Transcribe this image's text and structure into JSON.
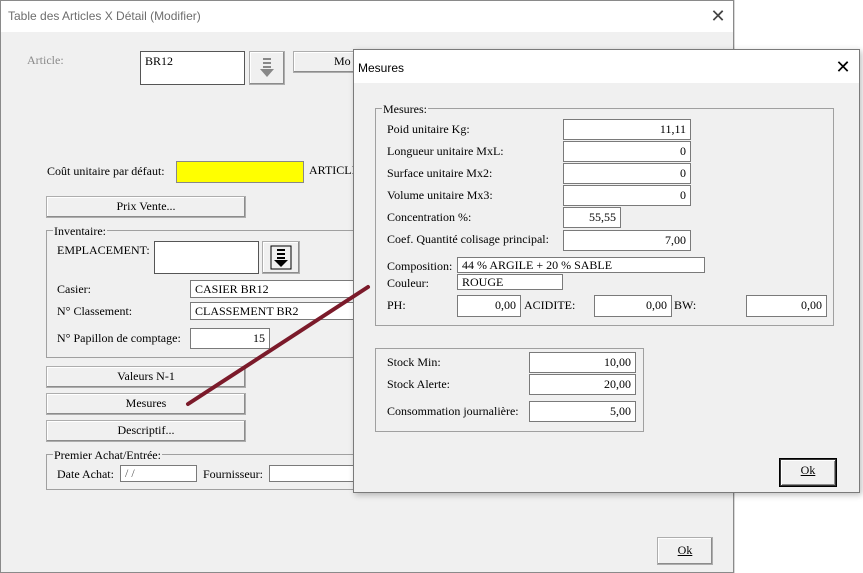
{
  "background_window": {
    "title": "Table des Articles X Détail (Modifier)",
    "article_label": "Article:",
    "article_value": "BR12",
    "mo_button_label": "Mo",
    "cout_label": "Coût unitaire par défaut:",
    "cout_value": "",
    "articles_partial": "ARTICLI",
    "prix_vente_button": "Prix Vente...",
    "inventaire_title": "Inventaire:",
    "emplacement_label": "EMPLACEMENT:",
    "emplacement_value": "",
    "casier_label": "Casier:",
    "casier_value": "CASIER BR12",
    "classement_label": "N° Classement:",
    "classement_value": "CLASSEMENT BR2",
    "papillon_label": "N° Papillon de comptage:",
    "papillon_value": "15",
    "valeurs_button": "Valeurs N-1",
    "mesures_button": "Mesures",
    "descriptif_button": "Descriptif...",
    "premier_title": "Premier Achat/Entrée:",
    "date_achat_label": "Date Achat:",
    "date_achat_value": " / /",
    "fournisseur_label": "Fournisseur:",
    "fournisseur_value": "",
    "ok_button": "Ok",
    "colors": {
      "cout_fill": "#ffff00",
      "window_bg": "#f0f0f0"
    }
  },
  "dialog": {
    "title": "Mesures",
    "mesures_group_title": "Mesures:",
    "poid_label": "Poid unitaire Kg:",
    "poid_value": "11,11",
    "longueur_label": "Longueur unitaire MxL:",
    "longueur_value": "0",
    "surface_label": "Surface unitaire Mx2:",
    "surface_value": "0",
    "volume_label": "Volume unitaire Mx3:",
    "volume_value": "0",
    "concentration_label": "Concentration %:",
    "concentration_value": "55,55",
    "coef_label": "Coef. Quantité colisage principal:",
    "coef_value": "7,00",
    "composition_label": "Composition:",
    "composition_value": "44 % ARGILE + 20 %  SABLE",
    "couleur_label": "Couleur:",
    "couleur_value": "ROUGE",
    "ph_label": "PH:",
    "ph_value": "0,00",
    "acidite_label": "ACIDITE:",
    "acidite_value": "0,00",
    "bw_label": "BW:",
    "bw_value": "0,00",
    "stock_min_label": "Stock Min:",
    "stock_min_value": "10,00",
    "stock_alerte_label": "Stock Alerte:",
    "stock_alerte_value": "20,00",
    "conso_label": "Consommation journalière:",
    "conso_value": "5,00",
    "ok_button": "Ok"
  },
  "annotation": {
    "arrow_color": "#7b1a2a"
  }
}
